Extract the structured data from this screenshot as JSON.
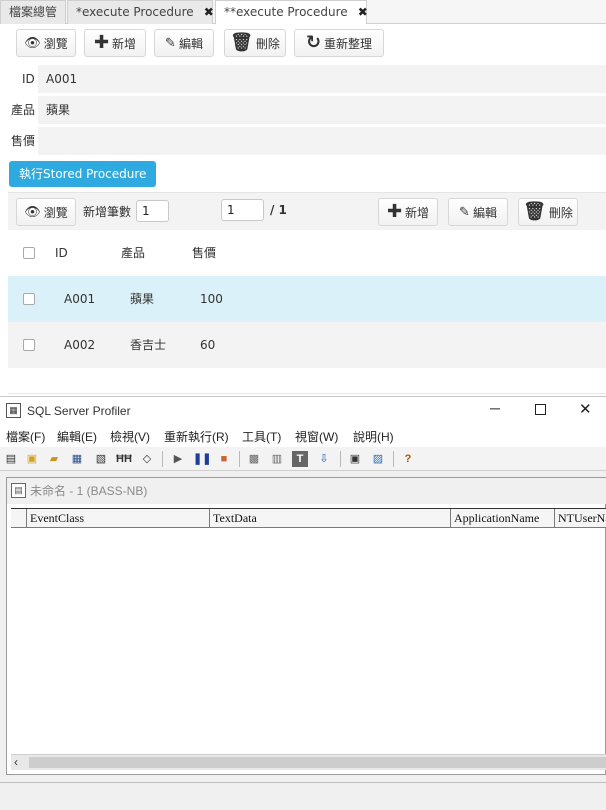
{
  "tabs": [
    {
      "label": "檔案總管",
      "active": false,
      "closable": false
    },
    {
      "label": "*execute Procedure",
      "active": false,
      "closable": true
    },
    {
      "label": "**execute Procedure",
      "active": true,
      "closable": true
    }
  ],
  "toolbar": {
    "browse": "瀏覽",
    "add": "新增",
    "edit": "編輯",
    "delete": "刪除",
    "refresh": "重新整理"
  },
  "form": {
    "id_label": "ID",
    "id_value": "A001",
    "product_label": "產品",
    "product_value": "蘋果",
    "price_label": "售價",
    "price_value": ""
  },
  "exec_button": "執行Stored Procedure",
  "grid_toolbar": {
    "browse": "瀏覽",
    "add_count_label": "新增筆數",
    "add_count_value": "1",
    "page_value": "1",
    "page_total": "/ 1",
    "add": "新增",
    "edit": "編輯",
    "delete": "刪除"
  },
  "grid": {
    "columns": [
      "ID",
      "產品",
      "售價"
    ],
    "rows": [
      {
        "id": "A001",
        "product": "蘋果",
        "price": "100",
        "selected": true
      },
      {
        "id": "A002",
        "product": "香吉士",
        "price": "60",
        "selected": false
      }
    ]
  },
  "profiler": {
    "title": "SQL Server Profiler",
    "menu": [
      "檔案(F)",
      "編輯(E)",
      "檢視(V)",
      "重新執行(R)",
      "工具(T)",
      "視窗(W)",
      "說明(H)"
    ],
    "trace_title": "未命名 - 1 (BASS-NB)",
    "columns": [
      "EventClass",
      "TextData",
      "ApplicationName",
      "NTUserName"
    ],
    "toolbar_icons": [
      "new-trace-icon",
      "new-template-icon",
      "open-icon",
      "save-icon",
      "properties-icon",
      "find-icon",
      "clear-icon",
      "play-icon",
      "pause-icon",
      "stop-icon",
      "group-icon",
      "column-icon",
      "text-icon",
      "autoscroll-icon",
      "tuning-advisor-icon",
      "performance-icon",
      "help-icon"
    ]
  },
  "colors": {
    "exec_button_bg": "#2eaae1",
    "selected_row_bg": "#dbf1f9",
    "alt_row_bg": "#f3f3f3"
  }
}
